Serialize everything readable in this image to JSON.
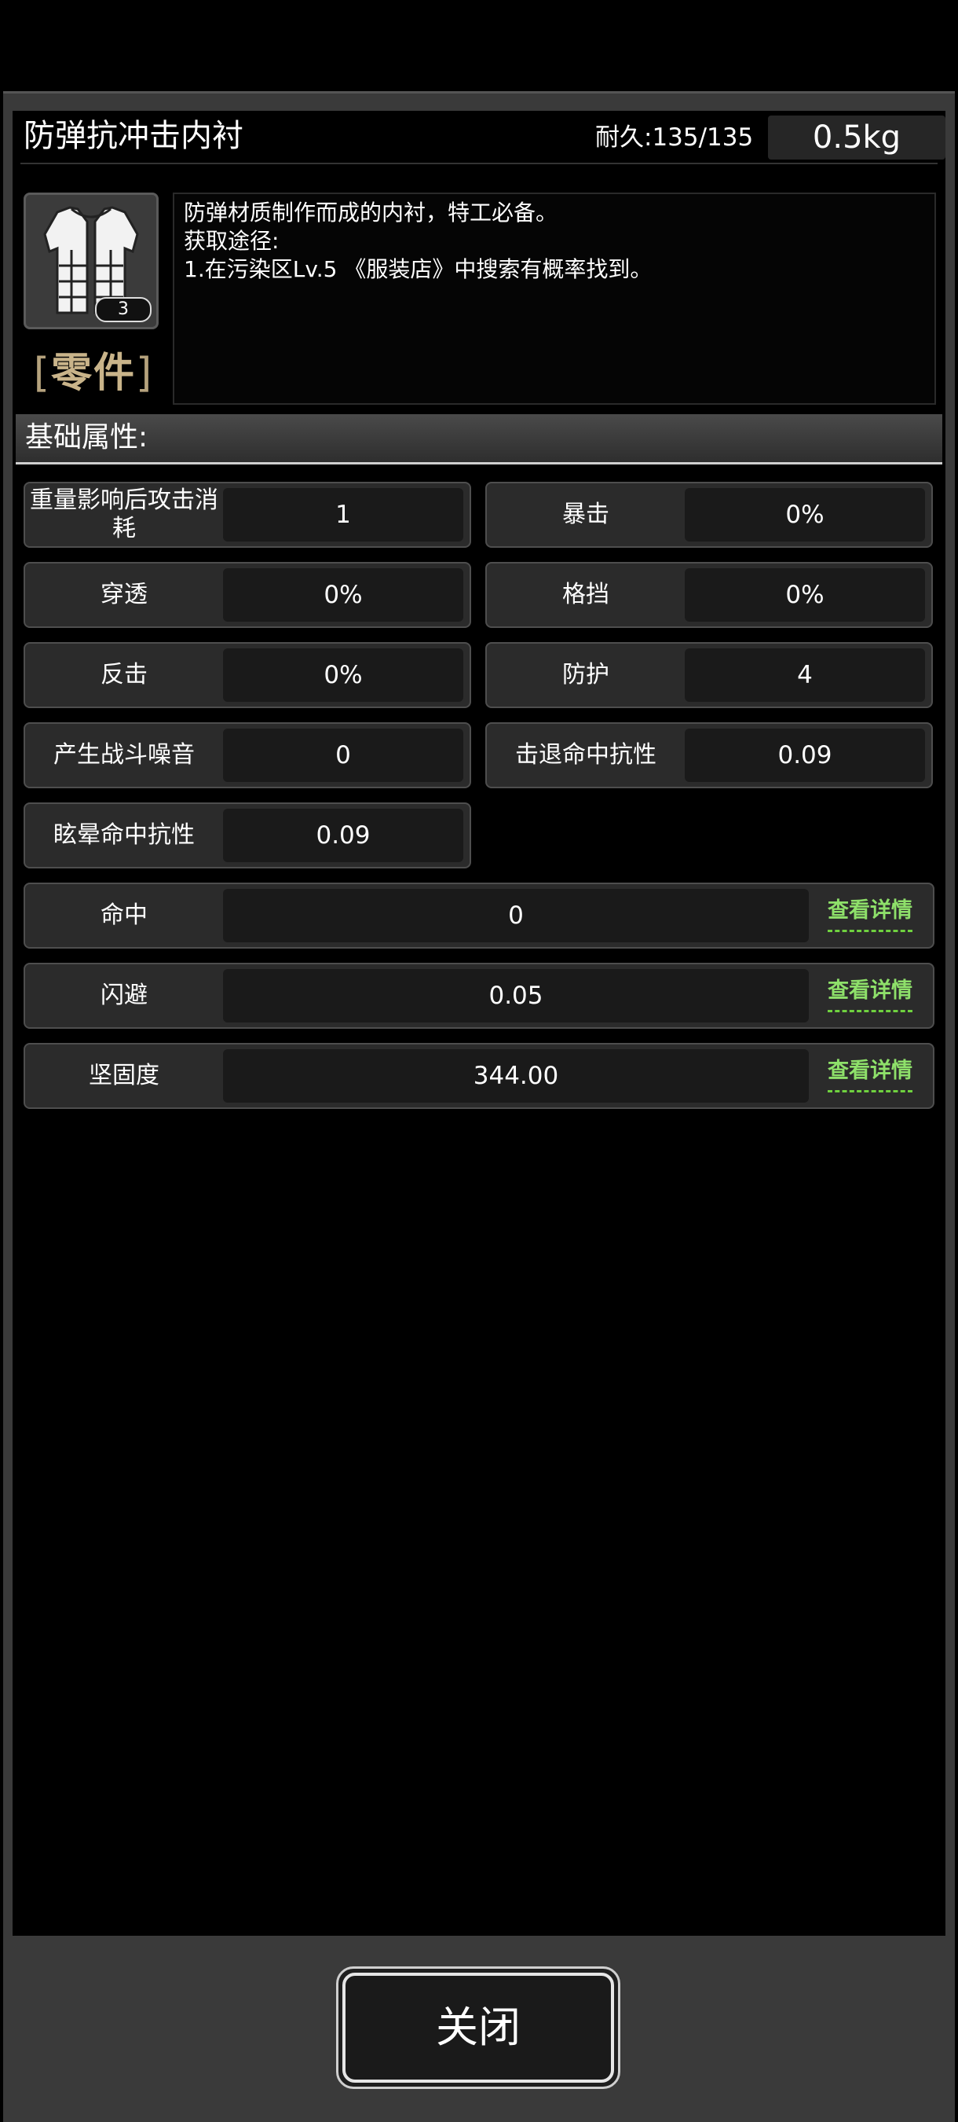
{
  "item": {
    "name": "防弹抗冲击内衬",
    "durability": "耐久:135/135",
    "weight": "0.5kg",
    "quantity": "3",
    "category": "零件",
    "category_open": "[",
    "category_close": "]",
    "description_lines": [
      "防弹材质制作而成的内衬，特工必备。",
      "获取途径:",
      "1.在污染区Lv.5 《服装店》中搜索有概率找到。"
    ]
  },
  "section": {
    "title": "基础属性:"
  },
  "stats": [
    {
      "label": "重量影响后攻击消耗",
      "value": "1"
    },
    {
      "label": "暴击",
      "value": "0%"
    },
    {
      "label": "穿透",
      "value": "0%"
    },
    {
      "label": "格挡",
      "value": "0%"
    },
    {
      "label": "反击",
      "value": "0%"
    },
    {
      "label": "防护",
      "value": "4"
    },
    {
      "label": "产生战斗噪音",
      "value": "0"
    },
    {
      "label": "击退命中抗性",
      "value": "0.09"
    },
    {
      "label": "眩晕命中抗性",
      "value": "0.09"
    }
  ],
  "wide_stats": [
    {
      "label": "命中",
      "value": "0",
      "link": "查看详情"
    },
    {
      "label": "闪避",
      "value": "0.05",
      "link": "查看详情"
    },
    {
      "label": "坚固度",
      "value": "344.00",
      "link": "查看详情"
    }
  ],
  "footer": {
    "close_label": "关闭"
  },
  "colors": {
    "link": "#8ee06a",
    "category": "#c9b48a",
    "panel": "#3a3a3a"
  },
  "icons": {
    "item_icon": "vest-icon"
  }
}
